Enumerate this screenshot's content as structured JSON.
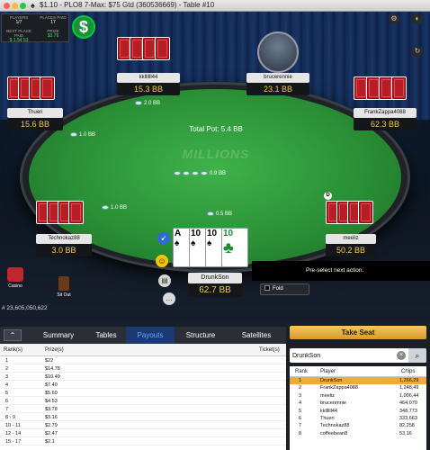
{
  "window": {
    "title": "$1.10 - PLO8 7-Max: $75 Gtd  (360536669) - Table #10",
    "suit": "♠"
  },
  "info": {
    "players_label": "PLAYERS",
    "players_val": "1/7",
    "places_label": "PLACES PAID",
    "places_val": "17",
    "next_label": "NEXT PLACE PAID",
    "next_val": "$ 1.54 53",
    "prize_label": "PRIZE",
    "prize_val": "$3.78"
  },
  "pot": {
    "label": "Total Pot: 5.4 BB"
  },
  "felt_logo": "MILLIONS",
  "seats": [
    {
      "name": "kkllllll44",
      "stack": "15.3 BB"
    },
    {
      "name": "brucerennie",
      "stack": "23.1 BB"
    },
    {
      "name": "Thueri",
      "stack": "15.6 BB"
    },
    {
      "name": "FrankZappa4088",
      "stack": "62.3 BB"
    },
    {
      "name": "Technokaz88",
      "stack": "3.0 BB"
    },
    {
      "name": "meeliz",
      "stack": "50.2 BB"
    }
  ],
  "bets": {
    "b1": "2.0 BB",
    "b2": "1.0 BB",
    "b3": "1.0 BB",
    "b4": "0.9 BB",
    "b5": "0.5 BB"
  },
  "dealer_label": "D",
  "hero": {
    "name": "DrunkSon",
    "stack": "62.7 BB",
    "cards": [
      {
        "rank": "A",
        "suit": "♠",
        "color": "#000000"
      },
      {
        "rank": "10",
        "suit": "♠",
        "color": "#000000"
      },
      {
        "rank": "10",
        "suit": "♠",
        "color": "#000000"
      },
      {
        "rank": "10",
        "suit": "♣",
        "color": "#1b8f2e"
      }
    ]
  },
  "actions": {
    "fold": "Fold",
    "preselect": "Pre-select next action."
  },
  "misc": {
    "casino": "Casino",
    "sitout": "Sit Out",
    "tournament_id": "# 23,605,050,622"
  },
  "tabs": [
    "Summary",
    "Tables",
    "Payouts",
    "Structure",
    "Satellites"
  ],
  "payouts": {
    "headers": [
      "Rank(s)",
      "Prize(s)",
      "Ticket(s)"
    ],
    "rows": [
      [
        "1",
        "$22"
      ],
      [
        "2",
        "$14.78"
      ],
      [
        "3",
        "$10.49"
      ],
      [
        "4",
        "$7.40"
      ],
      [
        "5",
        "$5.60"
      ],
      [
        "6",
        "$4.53"
      ],
      [
        "7",
        "$3.78"
      ],
      [
        "8 - 9",
        "$3.16"
      ],
      [
        "10 - 11",
        "$2.79"
      ],
      [
        "12 - 14",
        "$2.47"
      ],
      [
        "15 - 17",
        "$2.1"
      ]
    ]
  },
  "right": {
    "take_seat": "Take Seat",
    "search_value": "DrunkSon",
    "headers": [
      "Rank",
      "Player",
      "Chips"
    ],
    "rows": [
      [
        "1",
        "DrunkSon",
        "1,266,29"
      ],
      [
        "2",
        "FrankZappa4088",
        "1,248,49"
      ],
      [
        "3",
        "meeliz",
        "1,006,44"
      ],
      [
        "4",
        "brucerennie",
        "464,070"
      ],
      [
        "5",
        "kkllllll44",
        "348,773"
      ],
      [
        "6",
        "Thueri",
        "333,663"
      ],
      [
        "7",
        "Technokaz88",
        "82,258"
      ],
      [
        "8",
        "coffeebean8",
        "53,16"
      ]
    ]
  }
}
